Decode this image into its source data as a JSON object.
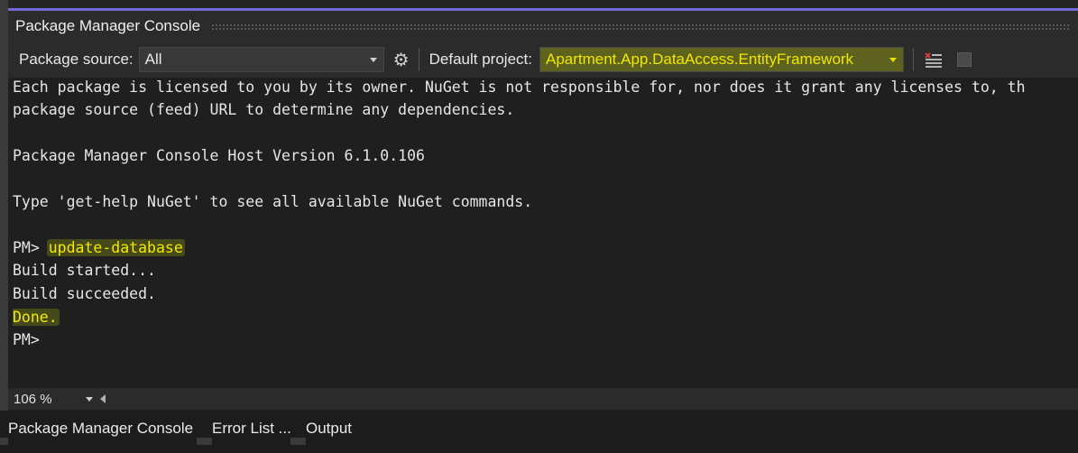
{
  "panel": {
    "title": "Package Manager Console"
  },
  "toolbar": {
    "package_source_label": "Package source:",
    "package_source_value": "All",
    "settings_icon": "gear-icon",
    "default_project_label": "Default project:",
    "default_project_value": "Apartment.App.DataAccess.EntityFramework",
    "clear_icon": "clear-console-icon",
    "stop_icon": "stop-icon"
  },
  "console": {
    "lines": [
      "Each package is licensed to you by its owner. NuGet is not responsible for, nor does it grant any licenses to, th",
      "package source (feed) URL to determine any dependencies.",
      "",
      "Package Manager Console Host Version 6.1.0.106",
      "",
      "Type 'get-help NuGet' to see all available NuGet commands.",
      "",
      "PM> ",
      "Build started...",
      "Build succeeded.",
      "Done.",
      "PM>"
    ],
    "command": "update-database"
  },
  "status": {
    "zoom": "106 %"
  },
  "tabs": [
    "Package Manager Console",
    "Error List ...",
    "Output"
  ],
  "colors": {
    "accent": "#6e6ad8",
    "highlight": "#f3ea00",
    "background": "#1f1f1f"
  }
}
